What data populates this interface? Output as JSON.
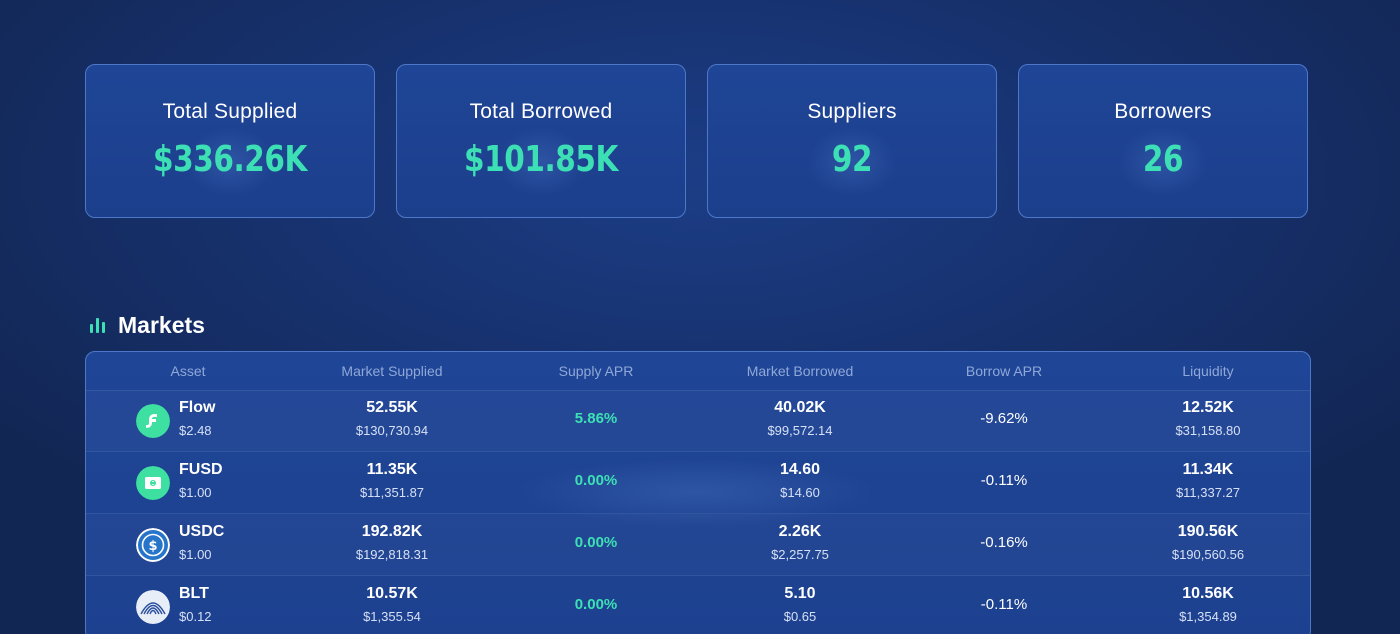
{
  "stats": [
    {
      "label": "Total Supplied",
      "value": "$336.26K"
    },
    {
      "label": "Total Borrowed",
      "value": "$101.85K"
    },
    {
      "label": "Suppliers",
      "value": "92"
    },
    {
      "label": "Borrowers",
      "value": "26"
    }
  ],
  "markets": {
    "title": "Markets",
    "icon": "bar-chart-icon",
    "columns": [
      "Asset",
      "Market Supplied",
      "Supply APR",
      "Market Borrowed",
      "Borrow APR",
      "Liquidity"
    ],
    "rows": [
      {
        "icon": "flow-token-icon",
        "name": "Flow",
        "price": "$2.48",
        "supplied": "52.55K",
        "supplied_usd": "$130,730.94",
        "supply_apr": "5.86%",
        "borrowed": "40.02K",
        "borrowed_usd": "$99,572.14",
        "borrow_apr": "-9.62%",
        "liquidity": "12.52K",
        "liquidity_usd": "$31,158.80"
      },
      {
        "icon": "fusd-token-icon",
        "name": "FUSD",
        "price": "$1.00",
        "supplied": "11.35K",
        "supplied_usd": "$11,351.87",
        "supply_apr": "0.00%",
        "borrowed": "14.60",
        "borrowed_usd": "$14.60",
        "borrow_apr": "-0.11%",
        "liquidity": "11.34K",
        "liquidity_usd": "$11,337.27"
      },
      {
        "icon": "usdc-token-icon",
        "name": "USDC",
        "price": "$1.00",
        "supplied": "192.82K",
        "supplied_usd": "$192,818.31",
        "supply_apr": "0.00%",
        "borrowed": "2.26K",
        "borrowed_usd": "$2,257.75",
        "borrow_apr": "-0.16%",
        "liquidity": "190.56K",
        "liquidity_usd": "$190,560.56"
      },
      {
        "icon": "blt-token-icon",
        "name": "BLT",
        "price": "$0.12",
        "supplied": "10.57K",
        "supplied_usd": "$1,355.54",
        "supply_apr": "0.00%",
        "borrowed": "5.10",
        "borrowed_usd": "$0.65",
        "borrow_apr": "-0.11%",
        "liquidity": "10.56K",
        "liquidity_usd": "$1,354.89"
      }
    ]
  },
  "colors": {
    "accent": "#3de0b4",
    "background": "#17326f",
    "card": "#1f4596",
    "border": "#4d78c9"
  }
}
